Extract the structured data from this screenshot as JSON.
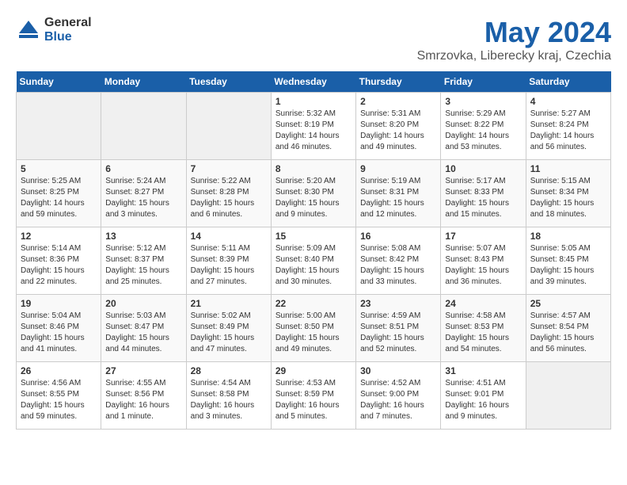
{
  "header": {
    "logo": {
      "general": "General",
      "blue": "Blue"
    },
    "title": "May 2024",
    "location": "Smrzovka, Liberecky kraj, Czechia"
  },
  "days_of_week": [
    "Sunday",
    "Monday",
    "Tuesday",
    "Wednesday",
    "Thursday",
    "Friday",
    "Saturday"
  ],
  "weeks": [
    [
      {
        "day": "",
        "content": ""
      },
      {
        "day": "",
        "content": ""
      },
      {
        "day": "",
        "content": ""
      },
      {
        "day": "1",
        "content": "Sunrise: 5:32 AM\nSunset: 8:19 PM\nDaylight: 14 hours\nand 46 minutes."
      },
      {
        "day": "2",
        "content": "Sunrise: 5:31 AM\nSunset: 8:20 PM\nDaylight: 14 hours\nand 49 minutes."
      },
      {
        "day": "3",
        "content": "Sunrise: 5:29 AM\nSunset: 8:22 PM\nDaylight: 14 hours\nand 53 minutes."
      },
      {
        "day": "4",
        "content": "Sunrise: 5:27 AM\nSunset: 8:24 PM\nDaylight: 14 hours\nand 56 minutes."
      }
    ],
    [
      {
        "day": "5",
        "content": "Sunrise: 5:25 AM\nSunset: 8:25 PM\nDaylight: 14 hours\nand 59 minutes."
      },
      {
        "day": "6",
        "content": "Sunrise: 5:24 AM\nSunset: 8:27 PM\nDaylight: 15 hours\nand 3 minutes."
      },
      {
        "day": "7",
        "content": "Sunrise: 5:22 AM\nSunset: 8:28 PM\nDaylight: 15 hours\nand 6 minutes."
      },
      {
        "day": "8",
        "content": "Sunrise: 5:20 AM\nSunset: 8:30 PM\nDaylight: 15 hours\nand 9 minutes."
      },
      {
        "day": "9",
        "content": "Sunrise: 5:19 AM\nSunset: 8:31 PM\nDaylight: 15 hours\nand 12 minutes."
      },
      {
        "day": "10",
        "content": "Sunrise: 5:17 AM\nSunset: 8:33 PM\nDaylight: 15 hours\nand 15 minutes."
      },
      {
        "day": "11",
        "content": "Sunrise: 5:15 AM\nSunset: 8:34 PM\nDaylight: 15 hours\nand 18 minutes."
      }
    ],
    [
      {
        "day": "12",
        "content": "Sunrise: 5:14 AM\nSunset: 8:36 PM\nDaylight: 15 hours\nand 22 minutes."
      },
      {
        "day": "13",
        "content": "Sunrise: 5:12 AM\nSunset: 8:37 PM\nDaylight: 15 hours\nand 25 minutes."
      },
      {
        "day": "14",
        "content": "Sunrise: 5:11 AM\nSunset: 8:39 PM\nDaylight: 15 hours\nand 27 minutes."
      },
      {
        "day": "15",
        "content": "Sunrise: 5:09 AM\nSunset: 8:40 PM\nDaylight: 15 hours\nand 30 minutes."
      },
      {
        "day": "16",
        "content": "Sunrise: 5:08 AM\nSunset: 8:42 PM\nDaylight: 15 hours\nand 33 minutes."
      },
      {
        "day": "17",
        "content": "Sunrise: 5:07 AM\nSunset: 8:43 PM\nDaylight: 15 hours\nand 36 minutes."
      },
      {
        "day": "18",
        "content": "Sunrise: 5:05 AM\nSunset: 8:45 PM\nDaylight: 15 hours\nand 39 minutes."
      }
    ],
    [
      {
        "day": "19",
        "content": "Sunrise: 5:04 AM\nSunset: 8:46 PM\nDaylight: 15 hours\nand 41 minutes."
      },
      {
        "day": "20",
        "content": "Sunrise: 5:03 AM\nSunset: 8:47 PM\nDaylight: 15 hours\nand 44 minutes."
      },
      {
        "day": "21",
        "content": "Sunrise: 5:02 AM\nSunset: 8:49 PM\nDaylight: 15 hours\nand 47 minutes."
      },
      {
        "day": "22",
        "content": "Sunrise: 5:00 AM\nSunset: 8:50 PM\nDaylight: 15 hours\nand 49 minutes."
      },
      {
        "day": "23",
        "content": "Sunrise: 4:59 AM\nSunset: 8:51 PM\nDaylight: 15 hours\nand 52 minutes."
      },
      {
        "day": "24",
        "content": "Sunrise: 4:58 AM\nSunset: 8:53 PM\nDaylight: 15 hours\nand 54 minutes."
      },
      {
        "day": "25",
        "content": "Sunrise: 4:57 AM\nSunset: 8:54 PM\nDaylight: 15 hours\nand 56 minutes."
      }
    ],
    [
      {
        "day": "26",
        "content": "Sunrise: 4:56 AM\nSunset: 8:55 PM\nDaylight: 15 hours\nand 59 minutes."
      },
      {
        "day": "27",
        "content": "Sunrise: 4:55 AM\nSunset: 8:56 PM\nDaylight: 16 hours\nand 1 minute."
      },
      {
        "day": "28",
        "content": "Sunrise: 4:54 AM\nSunset: 8:58 PM\nDaylight: 16 hours\nand 3 minutes."
      },
      {
        "day": "29",
        "content": "Sunrise: 4:53 AM\nSunset: 8:59 PM\nDaylight: 16 hours\nand 5 minutes."
      },
      {
        "day": "30",
        "content": "Sunrise: 4:52 AM\nSunset: 9:00 PM\nDaylight: 16 hours\nand 7 minutes."
      },
      {
        "day": "31",
        "content": "Sunrise: 4:51 AM\nSunset: 9:01 PM\nDaylight: 16 hours\nand 9 minutes."
      },
      {
        "day": "",
        "content": ""
      }
    ]
  ]
}
